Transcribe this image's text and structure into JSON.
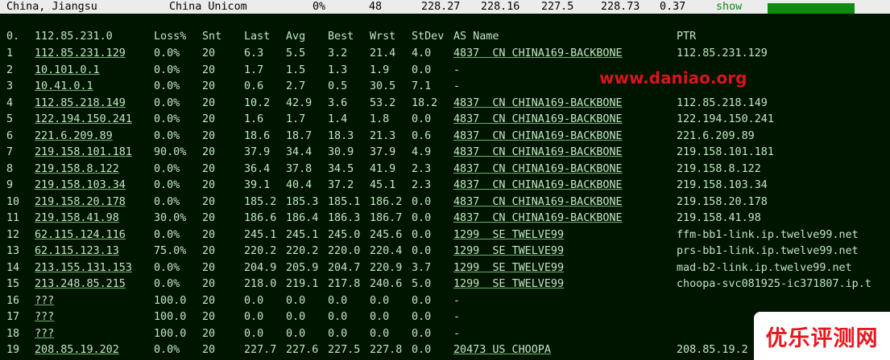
{
  "topbar": {
    "location": "China, Jiangsu",
    "isp": "China Unicom",
    "loss": "0%",
    "sent": "48",
    "last": "228.27",
    "avg": "228.16",
    "best": "227.5",
    "worst": "228.73",
    "stdev": "0.37",
    "show_label": "show"
  },
  "header": {
    "hop": "0.",
    "host": "112.85.231.0",
    "loss": "Loss%",
    "snt": "Snt",
    "last": "Last",
    "avg": "Avg",
    "best": "Best",
    "wrst": "Wrst",
    "stdev": "StDev",
    "as": "AS Name",
    "ptr": "PTR"
  },
  "hops": [
    {
      "hop": "1",
      "host": "112.85.231.129",
      "loss": "0.0%",
      "snt": "20",
      "last": "6.3",
      "avg": "5.5",
      "best": "3.2",
      "wrst": "21.4",
      "stdev": "4.0",
      "as": "4837  CN CHINA169-BACKBONE",
      "ptr": "112.85.231.129"
    },
    {
      "hop": "2",
      "host": "10.101.0.1",
      "loss": "0.0%",
      "snt": "20",
      "last": "1.7",
      "avg": "1.5",
      "best": "1.3",
      "wrst": "1.9",
      "stdev": "0.0",
      "as": "-",
      "ptr": ""
    },
    {
      "hop": "3",
      "host": "10.41.0.1",
      "loss": "0.0%",
      "snt": "20",
      "last": "0.6",
      "avg": "2.7",
      "best": "0.5",
      "wrst": "30.5",
      "stdev": "7.1",
      "as": "-",
      "ptr": ""
    },
    {
      "hop": "4",
      "host": "112.85.218.149",
      "loss": "0.0%",
      "snt": "20",
      "last": "10.2",
      "avg": "42.9",
      "best": "3.6",
      "wrst": "53.2",
      "stdev": "18.2",
      "as": "4837  CN CHINA169-BACKBONE",
      "ptr": "112.85.218.149"
    },
    {
      "hop": "5",
      "host": "122.194.150.241",
      "loss": "0.0%",
      "snt": "20",
      "last": "1.6",
      "avg": "1.7",
      "best": "1.4",
      "wrst": "1.8",
      "stdev": "0.0",
      "as": "4837  CN CHINA169-BACKBONE",
      "ptr": "122.194.150.241"
    },
    {
      "hop": "6",
      "host": "221.6.209.89",
      "loss": "0.0%",
      "snt": "20",
      "last": "18.6",
      "avg": "18.7",
      "best": "18.3",
      "wrst": "21.3",
      "stdev": "0.6",
      "as": "4837  CN CHINA169-BACKBONE",
      "ptr": "221.6.209.89"
    },
    {
      "hop": "7",
      "host": "219.158.101.181",
      "loss": "90.0%",
      "snt": "20",
      "last": "37.9",
      "avg": "34.4",
      "best": "30.9",
      "wrst": "37.9",
      "stdev": "4.9",
      "as": "4837  CN CHINA169-BACKBONE",
      "ptr": "219.158.101.181"
    },
    {
      "hop": "8",
      "host": "219.158.8.122",
      "loss": "0.0%",
      "snt": "20",
      "last": "36.4",
      "avg": "37.8",
      "best": "34.5",
      "wrst": "41.9",
      "stdev": "2.3",
      "as": "4837  CN CHINA169-BACKBONE",
      "ptr": "219.158.8.122"
    },
    {
      "hop": "9",
      "host": "219.158.103.34",
      "loss": "0.0%",
      "snt": "20",
      "last": "39.1",
      "avg": "40.4",
      "best": "37.2",
      "wrst": "45.1",
      "stdev": "2.3",
      "as": "4837  CN CHINA169-BACKBONE",
      "ptr": "219.158.103.34"
    },
    {
      "hop": "10",
      "host": "219.158.20.178",
      "loss": "0.0%",
      "snt": "20",
      "last": "185.2",
      "avg": "185.3",
      "best": "185.1",
      "wrst": "186.2",
      "stdev": "0.0",
      "as": "4837  CN CHINA169-BACKBONE",
      "ptr": "219.158.20.178"
    },
    {
      "hop": "11",
      "host": "219.158.41.98",
      "loss": "30.0%",
      "snt": "20",
      "last": "186.6",
      "avg": "186.4",
      "best": "186.3",
      "wrst": "186.7",
      "stdev": "0.0",
      "as": "4837  CN CHINA169-BACKBONE",
      "ptr": "219.158.41.98"
    },
    {
      "hop": "12",
      "host": "62.115.124.116",
      "loss": "0.0%",
      "snt": "20",
      "last": "245.1",
      "avg": "245.1",
      "best": "245.0",
      "wrst": "245.6",
      "stdev": "0.0",
      "as": "1299  SE TWELVE99",
      "ptr": "ffm-bb1-link.ip.twelve99.net"
    },
    {
      "hop": "13",
      "host": "62.115.123.13",
      "loss": "75.0%",
      "snt": "20",
      "last": "220.2",
      "avg": "220.2",
      "best": "220.0",
      "wrst": "220.4",
      "stdev": "0.0",
      "as": "1299  SE TWELVE99",
      "ptr": "prs-bb1-link.ip.twelve99.net"
    },
    {
      "hop": "14",
      "host": "213.155.131.153",
      "loss": "0.0%",
      "snt": "20",
      "last": "204.9",
      "avg": "205.9",
      "best": "204.7",
      "wrst": "220.9",
      "stdev": "3.7",
      "as": "1299  SE TWELVE99",
      "ptr": "mad-b2-link.ip.twelve99.net"
    },
    {
      "hop": "15",
      "host": "213.248.85.215",
      "loss": "0.0%",
      "snt": "20",
      "last": "218.0",
      "avg": "219.1",
      "best": "217.8",
      "wrst": "240.6",
      "stdev": "5.0",
      "as": "1299  SE TWELVE99",
      "ptr": "choopa-svc081925-ic371807.ip.t"
    },
    {
      "hop": "16",
      "host": "???",
      "loss": "100.0",
      "snt": "20",
      "last": "0.0",
      "avg": "0.0",
      "best": "0.0",
      "wrst": "0.0",
      "stdev": "0.0",
      "as": "-",
      "ptr": ""
    },
    {
      "hop": "17",
      "host": "???",
      "loss": "100.0",
      "snt": "20",
      "last": "0.0",
      "avg": "0.0",
      "best": "0.0",
      "wrst": "0.0",
      "stdev": "0.0",
      "as": "-",
      "ptr": ""
    },
    {
      "hop": "18",
      "host": "???",
      "loss": "100.0",
      "snt": "20",
      "last": "0.0",
      "avg": "0.0",
      "best": "0.0",
      "wrst": "0.0",
      "stdev": "0.0",
      "as": "-",
      "ptr": ""
    },
    {
      "hop": "19",
      "host": "208.85.19.202",
      "loss": "0.0%",
      "snt": "20",
      "last": "227.7",
      "avg": "227.6",
      "best": "227.5",
      "wrst": "227.8",
      "stdev": "0.0",
      "as": "20473 US CHOOPA",
      "ptr": "208.85.19.2"
    }
  ],
  "watermark": "www.daniao.org",
  "badge": "优乐评测网",
  "colors": {
    "terminal_bg": "#001500",
    "terminal_text": "#c3e5c3",
    "topbar_bg": "#ececec",
    "show_bar": "#0f8c0f",
    "watermark": "#d8151d"
  }
}
